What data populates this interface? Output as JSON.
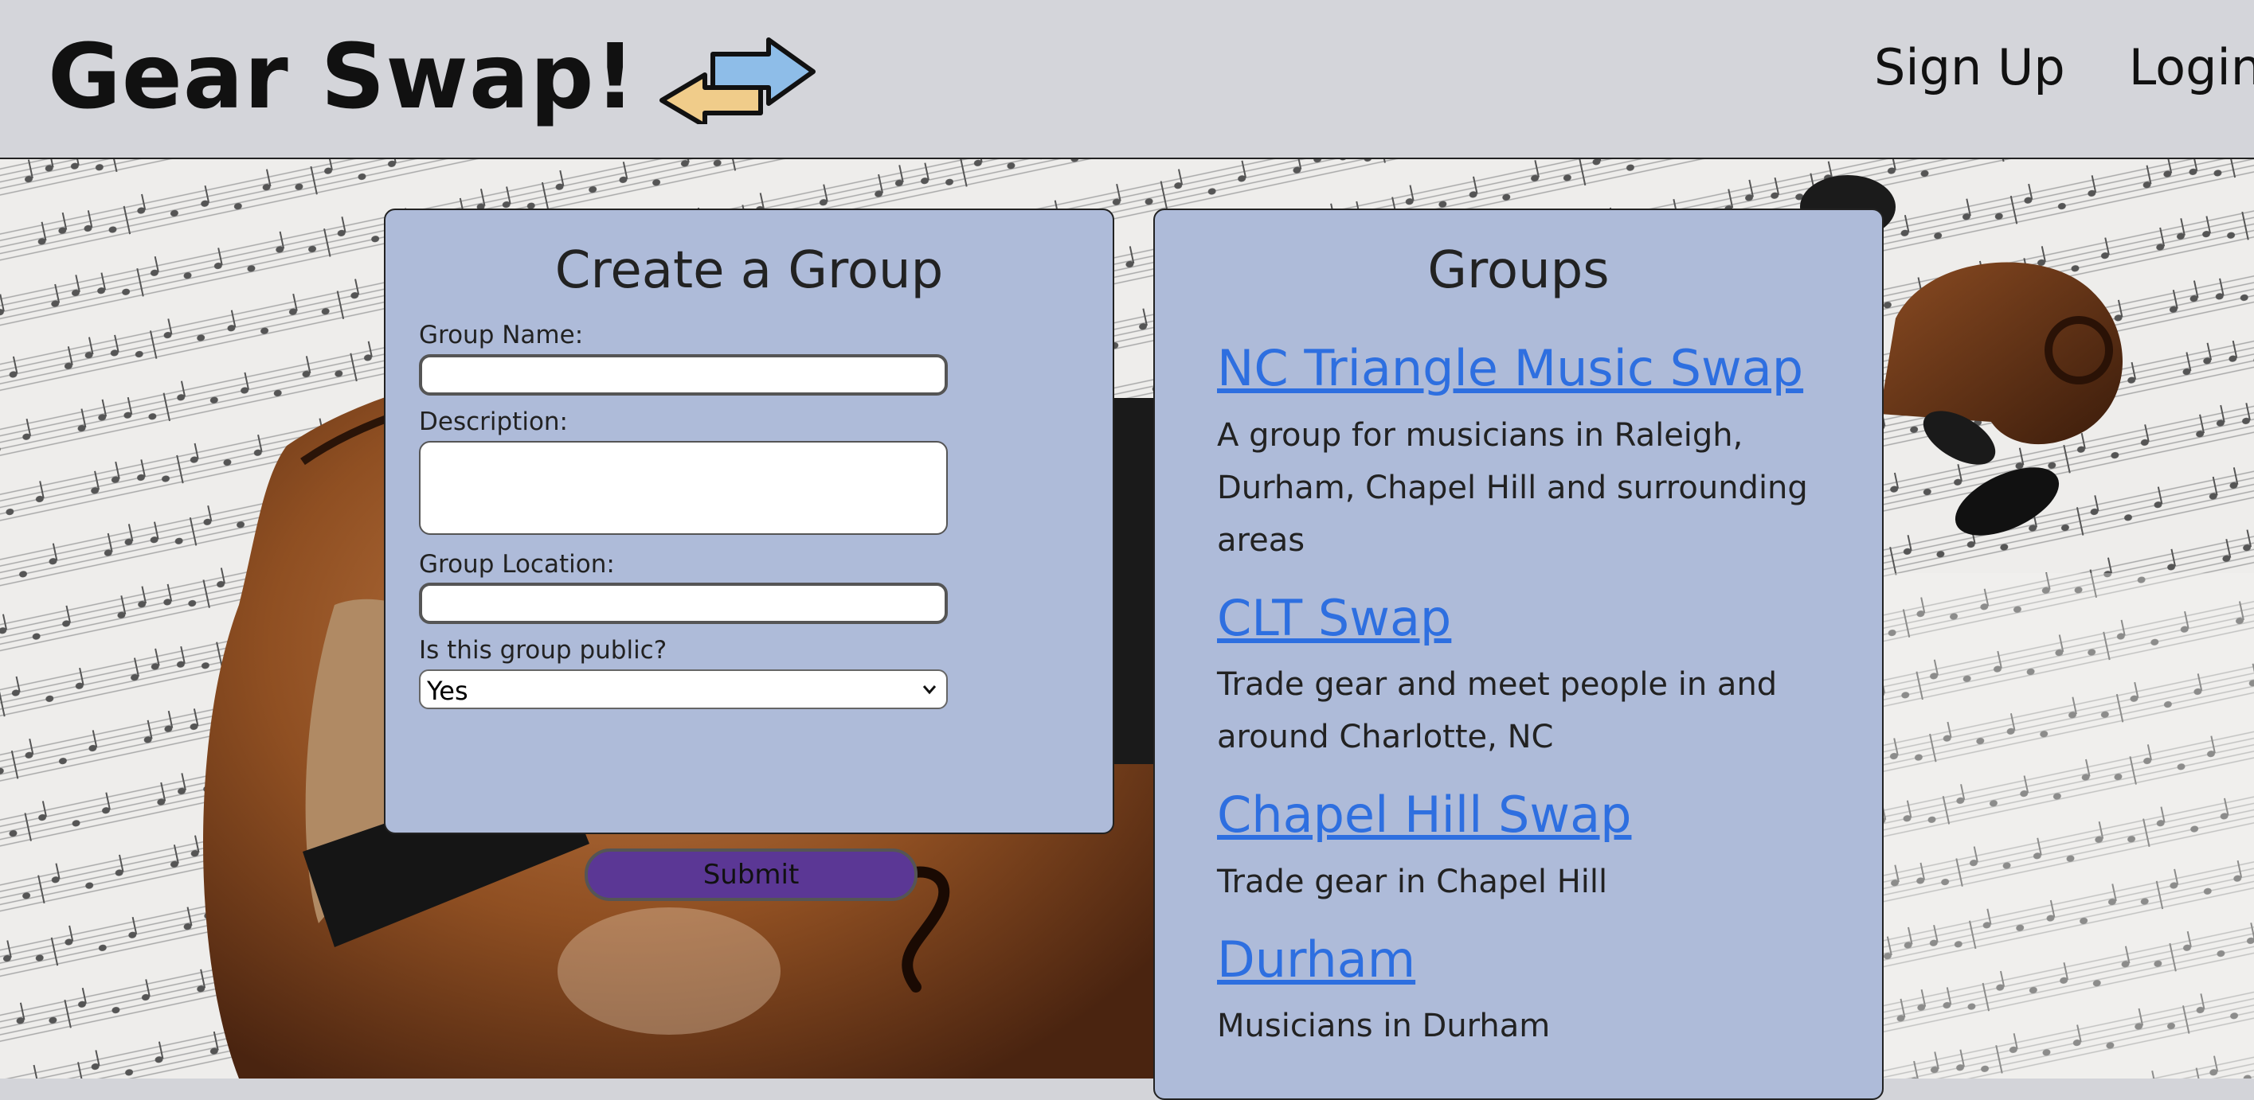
{
  "header": {
    "title": "Gear Swap!",
    "logo_icon": "swap-arrows-icon",
    "nav": {
      "signup": "Sign Up",
      "login": "Login"
    }
  },
  "create_group": {
    "title": "Create a Group",
    "fields": {
      "name_label": "Group Name:",
      "name_value": "",
      "description_label": "Description:",
      "description_value": "",
      "location_label": "Group Location:",
      "location_value": "",
      "public_label": "Is this group public?",
      "public_value": "Yes"
    },
    "submit_label": "Submit"
  },
  "groups": {
    "title": "Groups",
    "items": [
      {
        "name": "NC Triangle Music Swap",
        "description": "A group for musicians in Raleigh, Durham, Chapel Hill and surrounding areas"
      },
      {
        "name": "CLT Swap",
        "description": "Trade gear and meet people in and around Charlotte, NC"
      },
      {
        "name": "Chapel Hill Swap",
        "description": "Trade gear in Chapel Hill"
      },
      {
        "name": "Durham",
        "description": "Musicians in Durham"
      }
    ]
  },
  "colors": {
    "header_bg": "#d4d5da",
    "panel_bg": "#aebbd9",
    "link": "#2e6fe0",
    "submit_bg": "#5b3795"
  }
}
